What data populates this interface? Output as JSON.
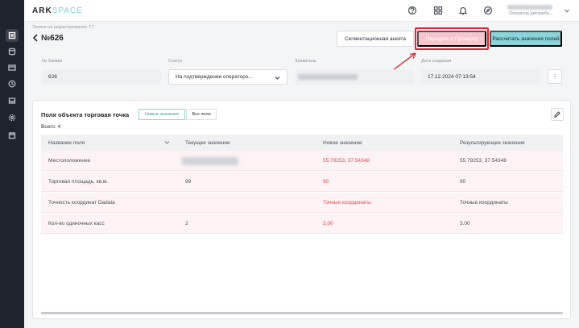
{
  "app": {
    "logo_main": "ARK",
    "logo_accent": "SPACE"
  },
  "user": {
    "role": "Оператор дистрибу..."
  },
  "header": {
    "breadcrumb": "Заявки на редактирование ТТ",
    "title": "№626"
  },
  "actions": {
    "segment_button": "Сегментационная анкета",
    "submit_button": "Передать в Проверку",
    "calc_button": "Рассчитать значения полей"
  },
  "fields": {
    "request_no_label": "№ Заявки",
    "request_no_value": "626",
    "status_label": "Статус",
    "status_value": "На подтверждении операторо...",
    "applicant_label": "Заявитель",
    "created_label": "Дата создания",
    "created_value": "17.12.2024 07:13:54",
    "more_glyph": "⋮"
  },
  "card": {
    "title": "Поля объекта торговая точка",
    "toggle_new": "Новые значения",
    "toggle_all": "Все поля",
    "total": "Всего: 4",
    "columns": [
      "Название поля",
      "Текущее значение",
      "Новое значение",
      "Результирующее значение"
    ],
    "rows": [
      {
        "name": "Местоположение",
        "current": "",
        "new": "55.79253, 37.54348",
        "result": "55.79253, 37.54348"
      },
      {
        "name": "Торговая площадь, кв.м.",
        "current": "99",
        "new": "90",
        "result": "90"
      },
      {
        "name": "Точность координат Dadata",
        "current": "",
        "new": "Точные координаты",
        "result": "Точные координаты"
      },
      {
        "name": "Кол-во одиночных касс",
        "current": "2",
        "new": "3.00",
        "result": "3.00"
      }
    ]
  },
  "colors": {
    "accent": "#8ad5db",
    "danger": "#e5484d",
    "highlight": "#e0262e"
  }
}
